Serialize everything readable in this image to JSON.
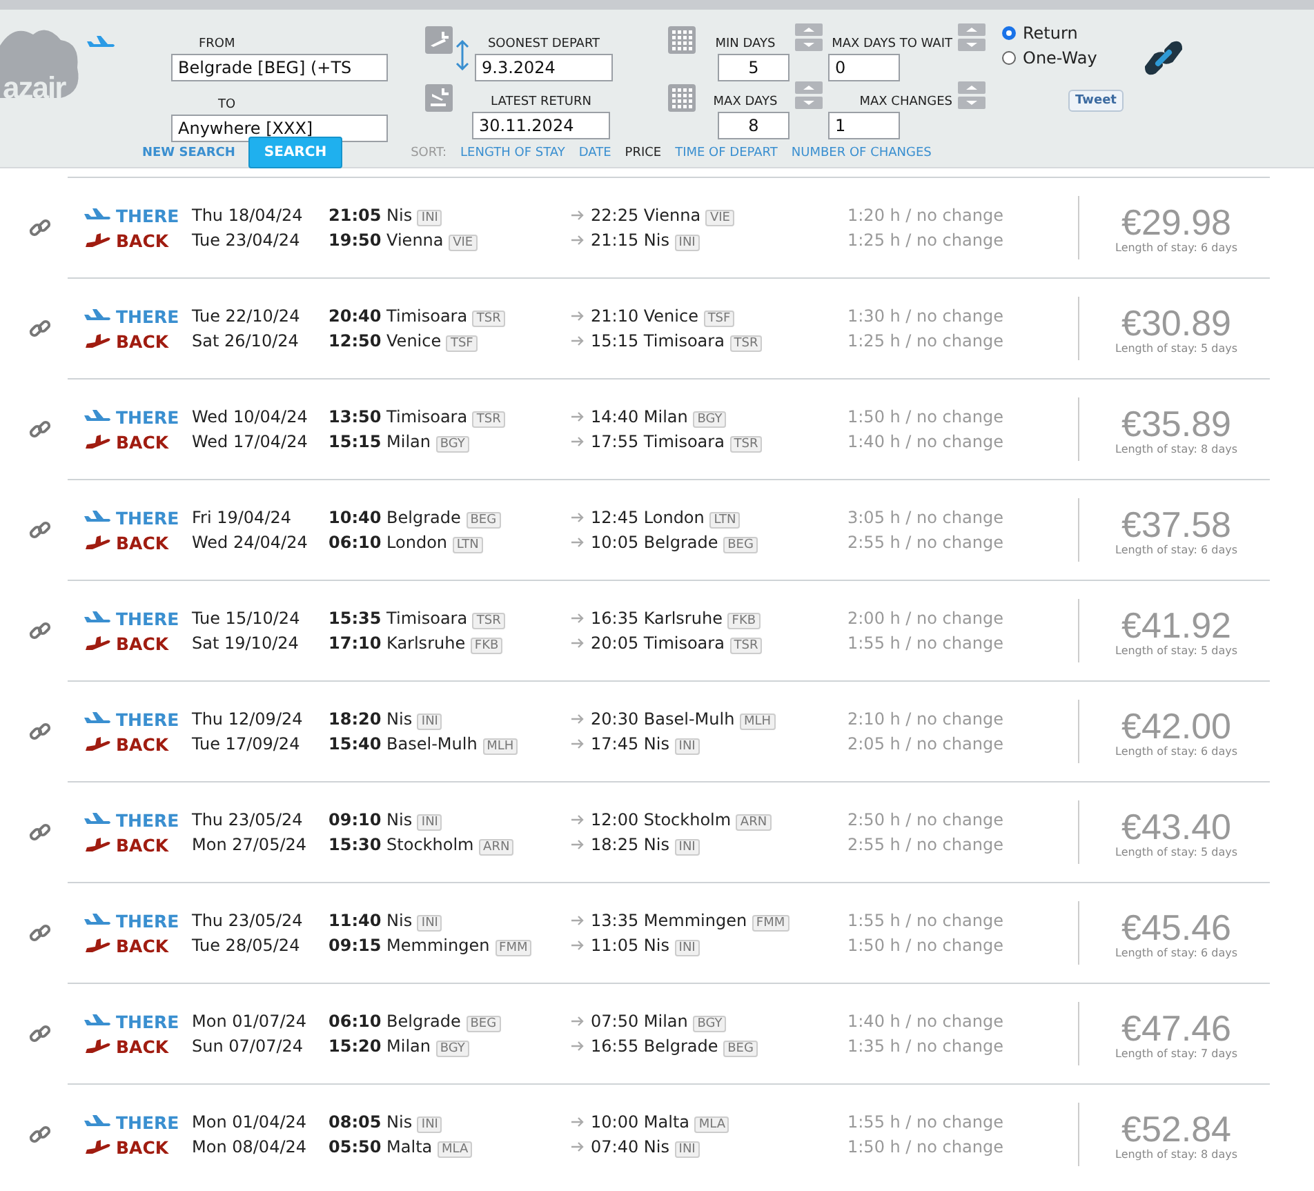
{
  "logo": {
    "text": "azair"
  },
  "search": {
    "from_label": "FROM",
    "from_value": "Belgrade [BEG] (+TS",
    "to_label": "TO",
    "to_value": "Anywhere [XXX]",
    "new_search": "NEW SEARCH",
    "search_button": "SEARCH",
    "soonest_label": "SOONEST DEPART",
    "soonest_value": "9.3.2024",
    "latest_label": "LATEST RETURN",
    "latest_value": "30.11.2024",
    "min_days_label": "MIN DAYS",
    "min_days_value": "5",
    "max_days_label": "MAX DAYS",
    "max_days_value": "8",
    "max_wait_label": "MAX DAYS TO WAIT",
    "max_wait_value": "0",
    "max_changes_label": "MAX CHANGES",
    "max_changes_value": "1",
    "trip_types": [
      {
        "label": "Return",
        "selected": true
      },
      {
        "label": "One-Way",
        "selected": false
      }
    ],
    "tweet": "Tweet"
  },
  "sort": {
    "label": "SORT:",
    "options": [
      {
        "label": "LENGTH OF STAY",
        "selected": false
      },
      {
        "label": "DATE",
        "selected": false
      },
      {
        "label": "PRICE",
        "selected": true
      },
      {
        "label": "TIME OF DEPART",
        "selected": false
      },
      {
        "label": "NUMBER OF CHANGES",
        "selected": false
      }
    ]
  },
  "results": [
    {
      "price": "€29.98",
      "stay": "Length of stay: 6 days",
      "legs": [
        {
          "kind": "there",
          "label": "THERE",
          "date": "Thu 18/04/24",
          "dep_time": "21:05",
          "dep_city": "Nis",
          "dep_code": "INI",
          "arr_time": "22:25",
          "arr_city": "Vienna",
          "arr_code": "VIE",
          "duration": "1:20 h / no change"
        },
        {
          "kind": "back",
          "label": "BACK",
          "date": "Tue 23/04/24",
          "dep_time": "19:50",
          "dep_city": "Vienna",
          "dep_code": "VIE",
          "arr_time": "21:15",
          "arr_city": "Nis",
          "arr_code": "INI",
          "duration": "1:25 h / no change"
        }
      ]
    },
    {
      "price": "€30.89",
      "stay": "Length of stay: 5 days",
      "legs": [
        {
          "kind": "there",
          "label": "THERE",
          "date": "Tue 22/10/24",
          "dep_time": "20:40",
          "dep_city": "Timisoara",
          "dep_code": "TSR",
          "arr_time": "21:10",
          "arr_city": "Venice",
          "arr_code": "TSF",
          "duration": "1:30 h / no change"
        },
        {
          "kind": "back",
          "label": "BACK",
          "date": "Sat 26/10/24",
          "dep_time": "12:50",
          "dep_city": "Venice",
          "dep_code": "TSF",
          "arr_time": "15:15",
          "arr_city": "Timisoara",
          "arr_code": "TSR",
          "duration": "1:25 h / no change"
        }
      ]
    },
    {
      "price": "€35.89",
      "stay": "Length of stay: 8 days",
      "legs": [
        {
          "kind": "there",
          "label": "THERE",
          "date": "Wed 10/04/24",
          "dep_time": "13:50",
          "dep_city": "Timisoara",
          "dep_code": "TSR",
          "arr_time": "14:40",
          "arr_city": "Milan",
          "arr_code": "BGY",
          "duration": "1:50 h / no change"
        },
        {
          "kind": "back",
          "label": "BACK",
          "date": "Wed 17/04/24",
          "dep_time": "15:15",
          "dep_city": "Milan",
          "dep_code": "BGY",
          "arr_time": "17:55",
          "arr_city": "Timisoara",
          "arr_code": "TSR",
          "duration": "1:40 h / no change"
        }
      ]
    },
    {
      "price": "€37.58",
      "stay": "Length of stay: 6 days",
      "legs": [
        {
          "kind": "there",
          "label": "THERE",
          "date": "Fri 19/04/24",
          "dep_time": "10:40",
          "dep_city": "Belgrade",
          "dep_code": "BEG",
          "arr_time": "12:45",
          "arr_city": "London",
          "arr_code": "LTN",
          "duration": "3:05 h / no change"
        },
        {
          "kind": "back",
          "label": "BACK",
          "date": "Wed 24/04/24",
          "dep_time": "06:10",
          "dep_city": "London",
          "dep_code": "LTN",
          "arr_time": "10:05",
          "arr_city": "Belgrade",
          "arr_code": "BEG",
          "duration": "2:55 h / no change"
        }
      ]
    },
    {
      "price": "€41.92",
      "stay": "Length of stay: 5 days",
      "legs": [
        {
          "kind": "there",
          "label": "THERE",
          "date": "Tue 15/10/24",
          "dep_time": "15:35",
          "dep_city": "Timisoara",
          "dep_code": "TSR",
          "arr_time": "16:35",
          "arr_city": "Karlsruhe",
          "arr_code": "FKB",
          "duration": "2:00 h / no change"
        },
        {
          "kind": "back",
          "label": "BACK",
          "date": "Sat 19/10/24",
          "dep_time": "17:10",
          "dep_city": "Karlsruhe",
          "dep_code": "FKB",
          "arr_time": "20:05",
          "arr_city": "Timisoara",
          "arr_code": "TSR",
          "duration": "1:55 h / no change"
        }
      ]
    },
    {
      "price": "€42.00",
      "stay": "Length of stay: 6 days",
      "legs": [
        {
          "kind": "there",
          "label": "THERE",
          "date": "Thu 12/09/24",
          "dep_time": "18:20",
          "dep_city": "Nis",
          "dep_code": "INI",
          "arr_time": "20:30",
          "arr_city": "Basel-Mulh",
          "arr_code": "MLH",
          "duration": "2:10 h / no change"
        },
        {
          "kind": "back",
          "label": "BACK",
          "date": "Tue 17/09/24",
          "dep_time": "15:40",
          "dep_city": "Basel-Mulh",
          "dep_code": "MLH",
          "arr_time": "17:45",
          "arr_city": "Nis",
          "arr_code": "INI",
          "duration": "2:05 h / no change"
        }
      ]
    },
    {
      "price": "€43.40",
      "stay": "Length of stay: 5 days",
      "legs": [
        {
          "kind": "there",
          "label": "THERE",
          "date": "Thu 23/05/24",
          "dep_time": "09:10",
          "dep_city": "Nis",
          "dep_code": "INI",
          "arr_time": "12:00",
          "arr_city": "Stockholm",
          "arr_code": "ARN",
          "duration": "2:50 h / no change"
        },
        {
          "kind": "back",
          "label": "BACK",
          "date": "Mon 27/05/24",
          "dep_time": "15:30",
          "dep_city": "Stockholm",
          "dep_code": "ARN",
          "arr_time": "18:25",
          "arr_city": "Nis",
          "arr_code": "INI",
          "duration": "2:55 h / no change"
        }
      ]
    },
    {
      "price": "€45.46",
      "stay": "Length of stay: 6 days",
      "legs": [
        {
          "kind": "there",
          "label": "THERE",
          "date": "Thu 23/05/24",
          "dep_time": "11:40",
          "dep_city": "Nis",
          "dep_code": "INI",
          "arr_time": "13:35",
          "arr_city": "Memmingen",
          "arr_code": "FMM",
          "duration": "1:55 h / no change"
        },
        {
          "kind": "back",
          "label": "BACK",
          "date": "Tue 28/05/24",
          "dep_time": "09:15",
          "dep_city": "Memmingen",
          "dep_code": "FMM",
          "arr_time": "11:05",
          "arr_city": "Nis",
          "arr_code": "INI",
          "duration": "1:50 h / no change"
        }
      ]
    },
    {
      "price": "€47.46",
      "stay": "Length of stay: 7 days",
      "legs": [
        {
          "kind": "there",
          "label": "THERE",
          "date": "Mon 01/07/24",
          "dep_time": "06:10",
          "dep_city": "Belgrade",
          "dep_code": "BEG",
          "arr_time": "07:50",
          "arr_city": "Milan",
          "arr_code": "BGY",
          "duration": "1:40 h / no change"
        },
        {
          "kind": "back",
          "label": "BACK",
          "date": "Sun 07/07/24",
          "dep_time": "15:20",
          "dep_city": "Milan",
          "dep_code": "BGY",
          "arr_time": "16:55",
          "arr_city": "Belgrade",
          "arr_code": "BEG",
          "duration": "1:35 h / no change"
        }
      ]
    },
    {
      "price": "€52.84",
      "stay": "Length of stay: 8 days",
      "legs": [
        {
          "kind": "there",
          "label": "THERE",
          "date": "Mon 01/04/24",
          "dep_time": "08:05",
          "dep_city": "Nis",
          "dep_code": "INI",
          "arr_time": "10:00",
          "arr_city": "Malta",
          "arr_code": "MLA",
          "duration": "1:55 h / no change"
        },
        {
          "kind": "back",
          "label": "BACK",
          "date": "Mon 08/04/24",
          "dep_time": "05:50",
          "dep_city": "Malta",
          "dep_code": "MLA",
          "arr_time": "07:40",
          "arr_city": "Nis",
          "arr_code": "INI",
          "duration": "1:50 h / no change"
        }
      ]
    }
  ]
}
